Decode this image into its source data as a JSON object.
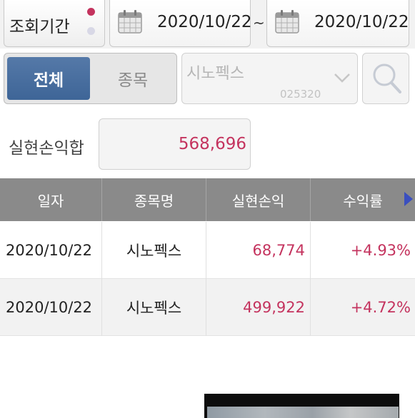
{
  "filter": {
    "period_label": "조회기간",
    "date_from": "2020/10/22",
    "date_separator": "~",
    "date_to": "2020/10/22"
  },
  "scope": {
    "all_label": "전체",
    "stock_label": "종목",
    "selected": "전체"
  },
  "stock_select": {
    "name": "시노펙스",
    "code": "025320"
  },
  "summary": {
    "label": "실현손익합",
    "value": "568,696"
  },
  "table": {
    "headers": [
      "일자",
      "종목명",
      "실현손익",
      "수익률"
    ],
    "rows": [
      {
        "date": "2020/10/22",
        "name": "시노펙스",
        "profit": "68,774",
        "rate": "+4.93%"
      },
      {
        "date": "2020/10/22",
        "name": "시노펙스",
        "profit": "499,922",
        "rate": "+4.72%"
      }
    ]
  },
  "icons": {
    "calendar": "calendar-icon",
    "search": "search-icon",
    "dropdown": "chevron-down-icon",
    "scroll": "arrow-right-icon"
  },
  "colors": {
    "accent_red": "#c4335e",
    "selected_blue": "#4a6fa0",
    "header_gray": "#8a8a8a",
    "scroll_arrow": "#3a4fbf"
  }
}
